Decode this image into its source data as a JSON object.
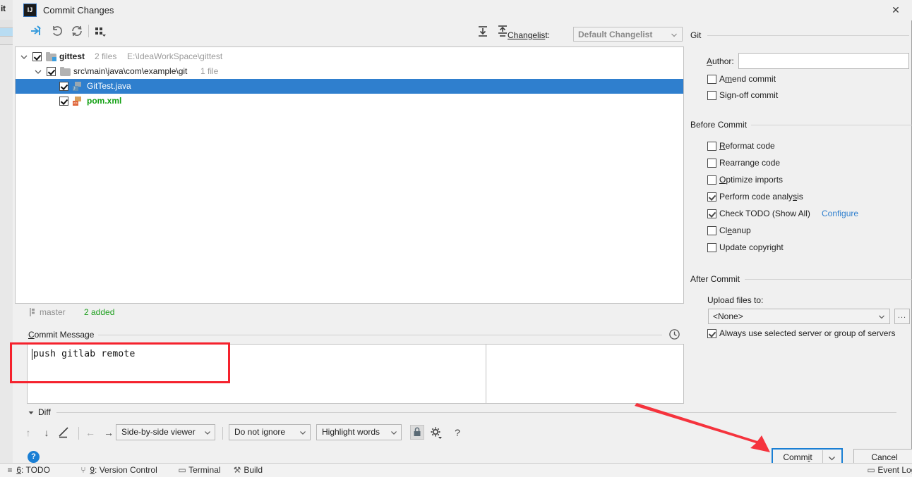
{
  "window": {
    "title": "Commit Changes",
    "app_icon": "intellij-idea-icon",
    "close_label": "✕"
  },
  "toolbar": {
    "buttons": [
      {
        "name": "show-diff-icon",
        "tooltip": "Show Diff"
      },
      {
        "name": "revert-icon",
        "tooltip": "Revert"
      },
      {
        "name": "refresh-icon",
        "tooltip": "Refresh Changes"
      },
      {
        "name": "group-by-icon",
        "tooltip": "Group By"
      }
    ],
    "changelist_label": "Changelist:",
    "changelist_label_mnemonic": "Changelis",
    "changelist_value": "Default Changelist"
  },
  "tree": {
    "nodes": [
      {
        "id": "gittest",
        "indent": 0,
        "expanded": true,
        "checked": true,
        "icon": "folder-modified-icon",
        "name": "gittest",
        "name_style": "bold",
        "meta": "2 files",
        "meta2": "E:\\IdeaWorkSpace\\gittest",
        "selected": false
      },
      {
        "id": "src-package",
        "indent": 1,
        "expanded": true,
        "checked": true,
        "icon": "folder-icon",
        "name": "src\\main\\java\\com\\example\\git",
        "name_style": "normal",
        "meta": "1 file",
        "meta2": "",
        "selected": false
      },
      {
        "id": "gittest-java",
        "indent": 2,
        "expanded": null,
        "checked": true,
        "icon": "java-file-icon",
        "name": "GitTest.java",
        "name_style": "selected",
        "meta": "",
        "meta2": "",
        "selected": true
      },
      {
        "id": "pom-xml",
        "indent": 1,
        "expanded": null,
        "checked": true,
        "icon": "xml-file-icon",
        "name": "pom.xml",
        "name_style": "added",
        "meta": "",
        "meta2": "",
        "selected": false
      }
    ]
  },
  "status": {
    "branch_icon": "git-branch-icon",
    "branch": "master",
    "added": "2 added"
  },
  "commit_message": {
    "label": "Commit Message",
    "label_mnemonic": "C",
    "value": "push gitlab remote",
    "history_icon": "clock-history-icon"
  },
  "diff": {
    "section_label": "Diff",
    "expanded": true,
    "buttons": [
      {
        "name": "previous-difference-icon",
        "glyph": "↑"
      },
      {
        "name": "next-difference-icon",
        "glyph": "↓"
      },
      {
        "name": "edit-source-icon",
        "glyph": "✎"
      },
      {
        "name": "previous-file-icon",
        "glyph": "←"
      },
      {
        "name": "next-file-icon",
        "glyph": "→"
      }
    ],
    "viewer_mode": "Side-by-side viewer",
    "ignore_policy": "Do not ignore",
    "highlight_policy": "Highlight words",
    "lock_icon": "lock-icon",
    "settings_icon": "gear-icon",
    "help_glyph": "?"
  },
  "right_panel": {
    "git": {
      "title": "Git",
      "author_label": "Author:",
      "author_label_mnemonic": "A",
      "author_value": "",
      "checkboxes": [
        {
          "name": "amend-commit",
          "label": "Amend commit",
          "mnemonic": "m",
          "checked": false
        },
        {
          "name": "sign-off-commit",
          "label": "Sign-off commit",
          "mnemonic": "g",
          "checked": false
        }
      ]
    },
    "before_commit": {
      "title": "Before Commit",
      "checkboxes": [
        {
          "name": "reformat-code",
          "label": "Reformat code",
          "mnemonic": "R",
          "checked": false
        },
        {
          "name": "rearrange-code",
          "label": "Rearrange code",
          "mnemonic": "",
          "checked": false
        },
        {
          "name": "optimize-imports",
          "label": "Optimize imports",
          "mnemonic": "O",
          "checked": false
        },
        {
          "name": "perform-code-analysis",
          "label": "Perform code analysis",
          "mnemonic": "s",
          "checked": true
        },
        {
          "name": "check-todo",
          "label": "Check TODO (Show All)",
          "mnemonic": "",
          "checked": true,
          "link": "Configure"
        },
        {
          "name": "cleanup",
          "label": "Cleanup",
          "mnemonic": "e",
          "checked": false
        },
        {
          "name": "update-copyright",
          "label": "Update copyright",
          "mnemonic": "",
          "checked": false
        }
      ]
    },
    "after_commit": {
      "title": "After Commit",
      "upload_label": "Upload files to:",
      "upload_value": "<None>",
      "browse_label": "...",
      "always_use_label": "Always use selected server or group of servers",
      "always_use_checked": true
    }
  },
  "footer": {
    "help_glyph": "?",
    "commit_label": "Commit",
    "commit_mnemonic": "i",
    "cancel_label": "Cancel"
  },
  "ide_statusbar": {
    "tool_window_label": "it",
    "items": [
      {
        "name": "statusbar-todo",
        "num": "6",
        "label": ": TODO",
        "icon": "list-icon"
      },
      {
        "name": "statusbar-version-control",
        "num": "9",
        "label": ": Version Control",
        "icon": "branch-icon"
      },
      {
        "name": "statusbar-terminal",
        "num": "",
        "label": "Terminal",
        "icon": "terminal-icon"
      },
      {
        "name": "statusbar-build",
        "num": "",
        "label": "Build",
        "icon": "hammer-icon"
      },
      {
        "name": "statusbar-event-log",
        "num": "",
        "label": "Event Log",
        "icon": "message-icon"
      }
    ]
  },
  "annotations": {
    "message_highlight_color": "#f5222d",
    "arrow_color": "#f5333d",
    "focus_color": "#1a7fd4"
  }
}
